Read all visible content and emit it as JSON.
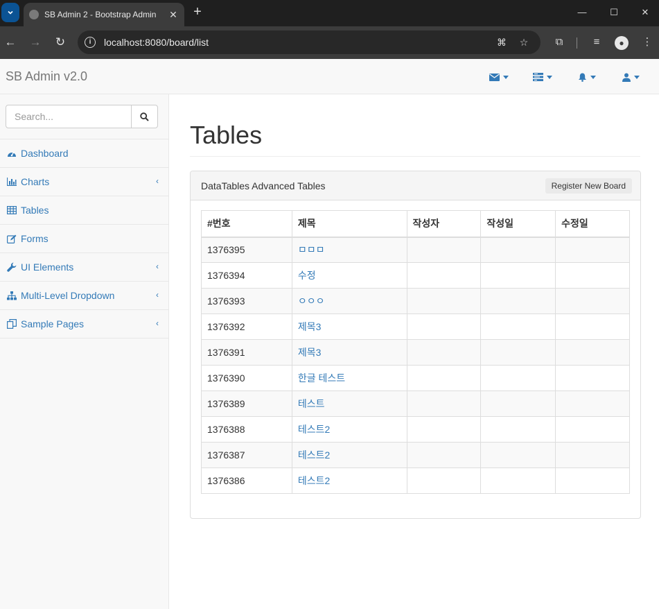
{
  "browser": {
    "tab_title": "SB Admin 2 - Bootstrap Admin",
    "url": "localhost:8080/board/list"
  },
  "navbar": {
    "brand": "SB Admin v2.0"
  },
  "sidebar": {
    "search_placeholder": "Search...",
    "items": [
      {
        "label": "Dashboard",
        "icon": "dashboard-icon",
        "has_children": false
      },
      {
        "label": "Charts",
        "icon": "bar-chart-icon",
        "has_children": true
      },
      {
        "label": "Tables",
        "icon": "table-icon",
        "has_children": false
      },
      {
        "label": "Forms",
        "icon": "edit-icon",
        "has_children": false
      },
      {
        "label": "UI Elements",
        "icon": "wrench-icon",
        "has_children": true
      },
      {
        "label": "Multi-Level Dropdown",
        "icon": "sitemap-icon",
        "has_children": true
      },
      {
        "label": "Sample Pages",
        "icon": "files-icon",
        "has_children": true
      }
    ]
  },
  "main": {
    "page_title": "Tables",
    "panel_title": "DataTables Advanced Tables",
    "register_button": "Register New Board",
    "table": {
      "headers": [
        "#번호",
        "제목",
        "작성자",
        "작성일",
        "수정일"
      ],
      "rows": [
        {
          "id": "1376395",
          "title": "ㅁㅁㅁ",
          "writer": "",
          "regdate": "",
          "updatedate": ""
        },
        {
          "id": "1376394",
          "title": "수정",
          "writer": "",
          "regdate": "",
          "updatedate": ""
        },
        {
          "id": "1376393",
          "title": "ㅇㅇㅇ",
          "writer": "",
          "regdate": "",
          "updatedate": ""
        },
        {
          "id": "1376392",
          "title": "제목3",
          "writer": "",
          "regdate": "",
          "updatedate": ""
        },
        {
          "id": "1376391",
          "title": "제목3",
          "writer": "",
          "regdate": "",
          "updatedate": ""
        },
        {
          "id": "1376390",
          "title": "한글 테스트",
          "writer": "",
          "regdate": "",
          "updatedate": ""
        },
        {
          "id": "1376389",
          "title": "테스트",
          "writer": "",
          "regdate": "",
          "updatedate": ""
        },
        {
          "id": "1376388",
          "title": "테스트2",
          "writer": "",
          "regdate": "",
          "updatedate": ""
        },
        {
          "id": "1376387",
          "title": "테스트2",
          "writer": "",
          "regdate": "",
          "updatedate": ""
        },
        {
          "id": "1376386",
          "title": "테스트2",
          "writer": "",
          "regdate": "",
          "updatedate": ""
        }
      ]
    }
  },
  "colors": {
    "link": "#337ab7",
    "navbar_bg": "#f8f8f8",
    "panel_heading_bg": "#f5f5f5"
  }
}
